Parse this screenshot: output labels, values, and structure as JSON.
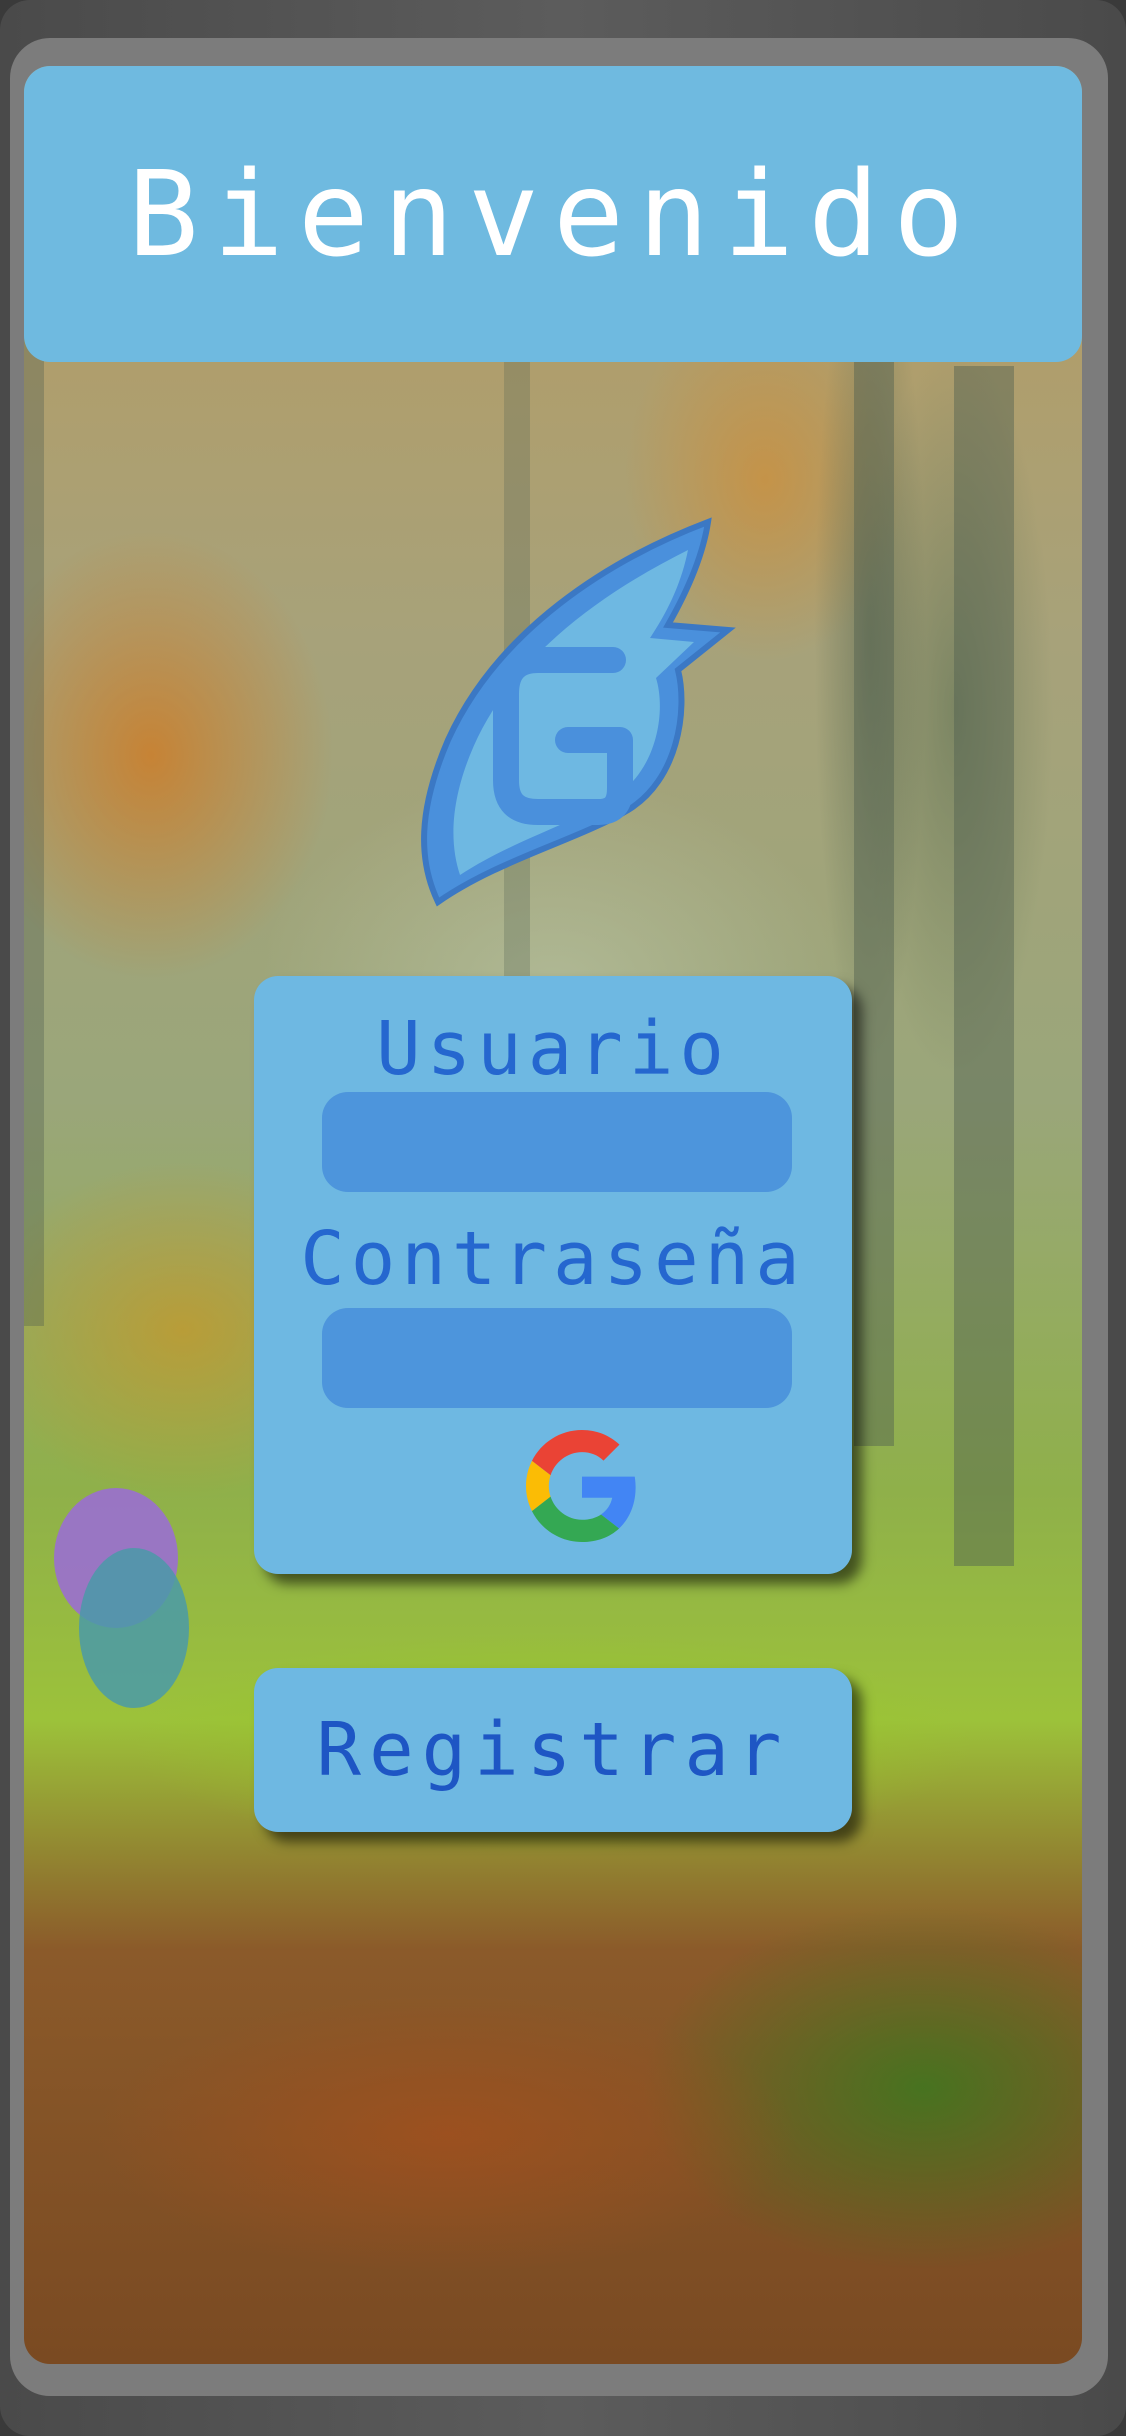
{
  "header": {
    "title": "Bienvenido"
  },
  "login": {
    "user_label": "Usuario",
    "user_value": "",
    "password_label": "Contraseña",
    "password_value": ""
  },
  "register": {
    "label": "Registrar"
  },
  "icons": {
    "app_logo": "blue-flame-g-logo-icon",
    "google": "google-icon"
  },
  "colors": {
    "header_bg": "#6fbae0",
    "panel_bg": "#6eb8e2",
    "field_bg": "#4d95dc",
    "label_text": "#2567cf",
    "header_text": "#ffffff"
  }
}
